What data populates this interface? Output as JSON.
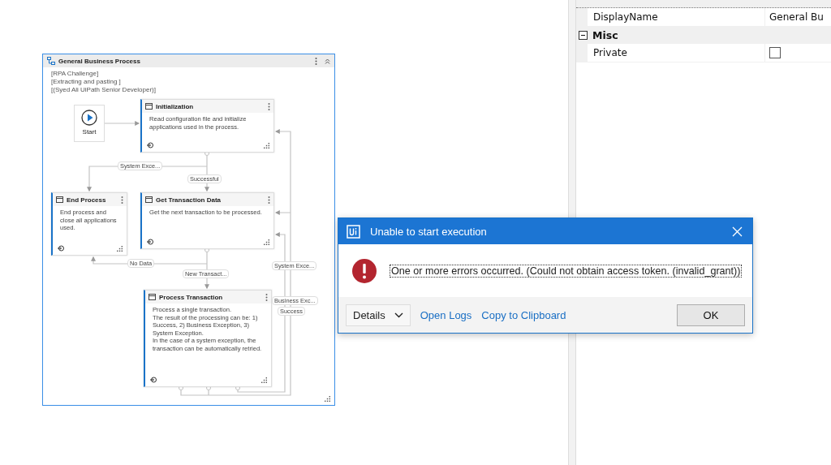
{
  "workflow": {
    "title": "General Business Process",
    "annotations": [
      "[RPA Challenge]",
      "[Extracting and pasting ]",
      "[(Syed Ali UiPath Senior Developer)]"
    ],
    "nodes": [
      {
        "kind": "start",
        "title": "Start"
      },
      {
        "kind": "state",
        "title": "Initialization",
        "description": "Read configuration file and initialize applications used in the process."
      },
      {
        "kind": "state",
        "title": "End Process",
        "description": "End process and close all applications used."
      },
      {
        "kind": "state",
        "title": "Get Transaction Data",
        "description": "Get the next transaction to be processed."
      },
      {
        "kind": "state",
        "title": "Process Transaction",
        "description": "Process a single transaction.\nThe result of the processing can be: 1) Success, 2) Business Exception, 3) System Exception.\nIn the case of a system exception, the transaction can be automatically retried."
      }
    ],
    "transition_labels": [
      "System Exce...",
      "Successful",
      "No Data",
      "New Transact...",
      "System Exce...",
      "Business Exc...",
      "Success"
    ]
  },
  "properties": [
    {
      "kind": "property",
      "name": "DisplayName",
      "value": "General Bu"
    },
    {
      "kind": "category",
      "name": "Misc",
      "expanded": true
    },
    {
      "kind": "checkbox",
      "name": "Private",
      "checked": false
    }
  ],
  "dialog": {
    "title": "Unable to start execution",
    "message": "One or more errors occurred. (Could not obtain access token. (invalid_grant))",
    "details_button": "Details",
    "links": [
      "Open Logs",
      "Copy to Clipboard"
    ],
    "ok_button": "OK"
  }
}
